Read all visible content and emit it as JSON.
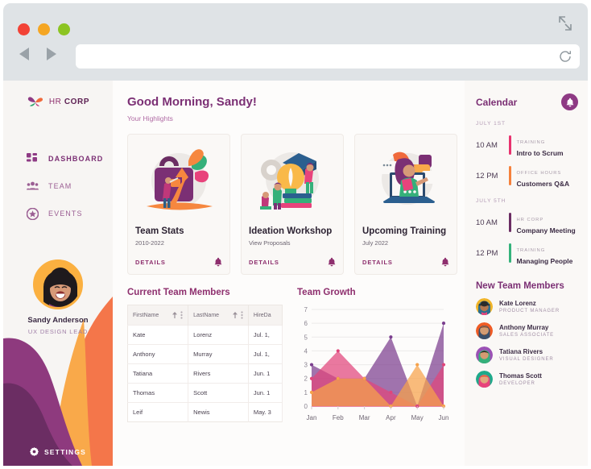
{
  "browser": {
    "reload_icon": "reload-icon",
    "back_icon": "back-arrow-icon",
    "forward_icon": "forward-arrow-icon",
    "expand_icon": "expand-icon",
    "url_value": "",
    "url_placeholder": ""
  },
  "sidebar": {
    "logo_prefix": "HR ",
    "logo_bold": "CORP",
    "items": [
      {
        "label": "DASHBOARD",
        "icon": "grid-icon",
        "active": true
      },
      {
        "label": "TEAM",
        "icon": "people-icon",
        "active": false
      },
      {
        "label": "EVENTS",
        "icon": "star-badge-icon",
        "active": false
      }
    ],
    "profile": {
      "name": "Sandy Anderson",
      "role": "UX DESIGN LEAD",
      "avatar": "avatar-sandy"
    },
    "settings_label": "SETTINGS",
    "settings_icon": "gear-icon",
    "wave_colors": {
      "orange": "#f4764a",
      "amber": "#f9a94a",
      "purple": "#8e3a7e",
      "deep_purple": "#6b2d63"
    }
  },
  "main": {
    "greeting": "Good Morning, Sandy!",
    "subtitle": "Your Highlights",
    "cards": [
      {
        "title": "Team Stats",
        "subtitle": "2010-2022",
        "details": "DETAILS",
        "bell_icon": "bell-icon",
        "illustration": "briefcase-growth-illustration"
      },
      {
        "title": "Ideation Workshop",
        "subtitle": "View Proposals",
        "details": "DETAILS",
        "bell_icon": "bell-icon",
        "illustration": "lightbulb-books-illustration"
      },
      {
        "title": "Upcoming Training",
        "subtitle": "July 2022",
        "details": "DETAILS",
        "bell_icon": "bell-icon",
        "illustration": "laptop-presenter-illustration"
      }
    ],
    "table": {
      "title": "Current Team Members",
      "columns": [
        "FirstName",
        "LastName",
        "HireDa"
      ],
      "sort_icon": "sort-asc-icon",
      "menu_icon": "more-vertical-icon",
      "rows": [
        [
          "Kate",
          "Lorenz",
          "Jul. 1,"
        ],
        [
          "Anthony",
          "Murray",
          "Jul. 1,"
        ],
        [
          "Tatiana",
          "Rivers",
          "Jun. 1"
        ],
        [
          "Thomas",
          "Scott",
          "Jun. 1"
        ],
        [
          "Leif",
          "Newis",
          "May. 3"
        ]
      ]
    },
    "chart_title": "Team Growth"
  },
  "chart_data": {
    "type": "area",
    "title": "Team Growth",
    "categories": [
      "Jan",
      "Feb",
      "Mar",
      "Apr",
      "May",
      "Jun"
    ],
    "series": [
      {
        "name": "purple",
        "color": "#7b3f8f",
        "values": [
          3,
          2,
          2,
          5,
          0,
          6
        ]
      },
      {
        "name": "pink",
        "color": "#e0457b",
        "values": [
          2,
          4,
          2,
          1,
          0,
          3
        ]
      },
      {
        "name": "orange",
        "color": "#f6a24a",
        "values": [
          1,
          2,
          2,
          0,
          3,
          0
        ]
      }
    ],
    "xlabel": "",
    "ylabel": "",
    "ylim": [
      0,
      7
    ],
    "yticks": [
      0,
      1,
      2,
      3,
      4,
      5,
      6,
      7
    ],
    "grid": true,
    "legend": "none"
  },
  "rail": {
    "calendar_title": "Calendar",
    "bell_icon": "bell-icon",
    "groups": [
      {
        "day": "JULY 1ST",
        "events": [
          {
            "time": "10 AM",
            "category": "TRAINING",
            "name": "Intro to Scrum",
            "color": "#e8336f"
          },
          {
            "time": "12 PM",
            "category": "OFFICE HOURS",
            "name": "Customers Q&A",
            "color": "#f5813c"
          }
        ]
      },
      {
        "day": "JULY 5TH",
        "events": [
          {
            "time": "10 AM",
            "category": "HR CORP",
            "name": "Company Meeting",
            "color": "#6b2d63"
          },
          {
            "time": "12 PM",
            "category": "TRAINING",
            "name": "Managing People",
            "color": "#34b27b"
          }
        ]
      }
    ],
    "members_title": "New Team Members",
    "members": [
      {
        "name": "Kate Lorenz",
        "role": "PRODUCT MANAGER",
        "color": "#f0b429",
        "avatar": "avatar-kate"
      },
      {
        "name": "Anthony Murray",
        "role": "SALES ASSOCIATE",
        "color": "#ef5b24",
        "avatar": "avatar-anthony"
      },
      {
        "name": "Tatiana Rivers",
        "role": "VISUAL DESIGNER",
        "color": "#9b51b5",
        "avatar": "avatar-tatiana"
      },
      {
        "name": "Thomas Scott",
        "role": "DEVELOPER",
        "color": "#1fa98a",
        "avatar": "avatar-thomas"
      }
    ]
  }
}
